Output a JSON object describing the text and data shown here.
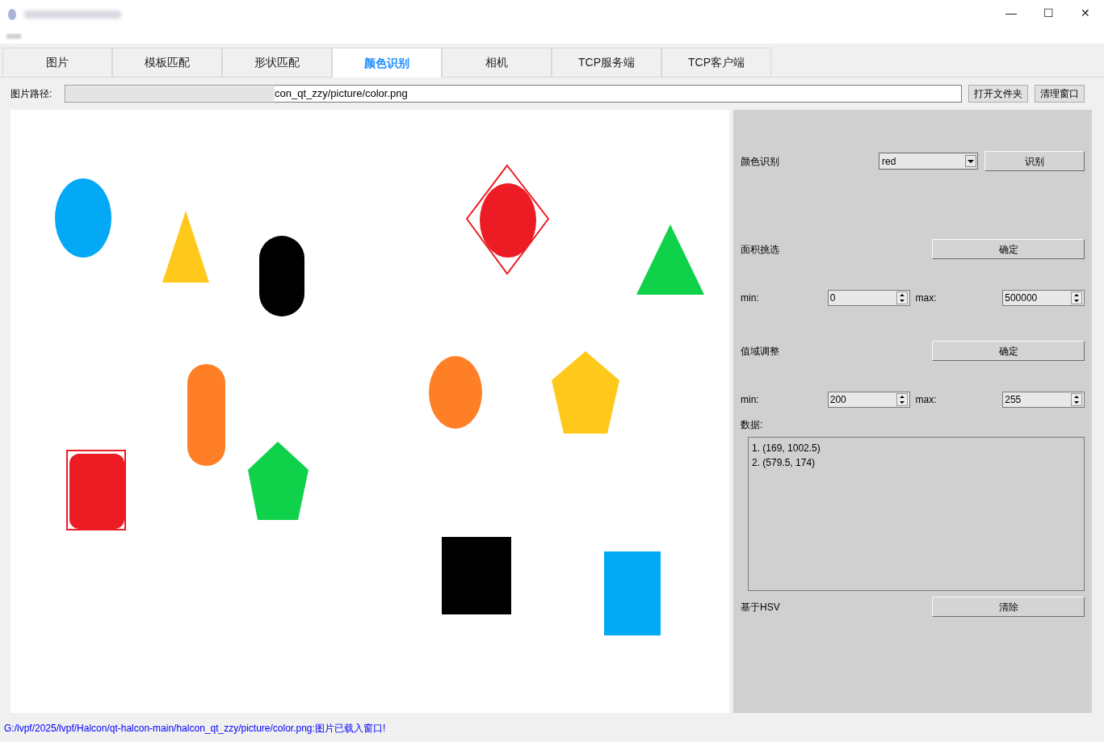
{
  "window": {
    "controls": [
      "—",
      "☐",
      "✕"
    ]
  },
  "tabs": [
    {
      "label": "图片",
      "selected": false
    },
    {
      "label": "模板匹配",
      "selected": false
    },
    {
      "label": "形状匹配",
      "selected": false
    },
    {
      "label": "颜色识别",
      "selected": true
    },
    {
      "label": "相机",
      "selected": false
    },
    {
      "label": "TCP服务端",
      "selected": false
    },
    {
      "label": "TCP客户端",
      "selected": false
    }
  ],
  "path": {
    "label": "图片路径:",
    "value": "con_qt_zzy/picture/color.png",
    "buttons": [
      "打开文件夹",
      "清理窗口"
    ]
  },
  "panel": {
    "color": {
      "label": "颜色识别",
      "value": "red",
      "button": "识别"
    },
    "area": {
      "label": "面积挑选",
      "button": "确定",
      "min_label": "min:",
      "min": "0",
      "max_label": "max:",
      "max": "500000"
    },
    "range": {
      "label": "值域调整",
      "button": "确定",
      "min_label": "min:",
      "min": "200",
      "max_label": "max:",
      "max": "255"
    },
    "data": {
      "label": "数据:",
      "lines": [
        "1. (169, 1002.5)",
        "2. (579.5, 174)"
      ]
    },
    "hsv": {
      "label": "基于HSV",
      "button": "清除"
    }
  },
  "status_bar": "G:/lvpf/2025/lvpf/Halcon/qt-halcon-main/halcon_qt_zzy/picture/color.png:图片已载入窗口!"
}
